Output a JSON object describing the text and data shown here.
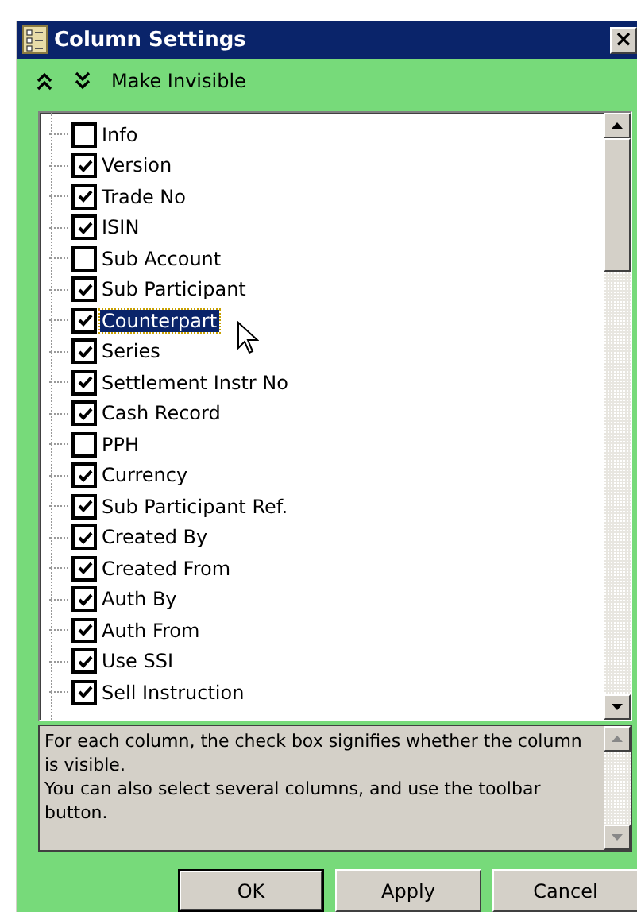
{
  "window": {
    "title": "Column Settings",
    "close": "×"
  },
  "toolbar": {
    "label": "Make Invisible"
  },
  "columns": [
    {
      "label": "Info",
      "checked": false,
      "selected": false
    },
    {
      "label": "Version",
      "checked": true,
      "selected": false
    },
    {
      "label": "Trade No",
      "checked": true,
      "selected": false
    },
    {
      "label": "ISIN",
      "checked": true,
      "selected": false
    },
    {
      "label": "Sub Account",
      "checked": false,
      "selected": false
    },
    {
      "label": "Sub Participant",
      "checked": true,
      "selected": false
    },
    {
      "label": "Counterpart",
      "checked": true,
      "selected": true
    },
    {
      "label": "Series",
      "checked": true,
      "selected": false
    },
    {
      "label": "Settlement Instr No",
      "checked": true,
      "selected": false
    },
    {
      "label": "Cash Record",
      "checked": true,
      "selected": false
    },
    {
      "label": "PPH",
      "checked": false,
      "selected": false
    },
    {
      "label": "Currency",
      "checked": true,
      "selected": false
    },
    {
      "label": "Sub Participant Ref.",
      "checked": true,
      "selected": false
    },
    {
      "label": "Created By",
      "checked": true,
      "selected": false
    },
    {
      "label": "Created From",
      "checked": true,
      "selected": false
    },
    {
      "label": "Auth By",
      "checked": true,
      "selected": false
    },
    {
      "label": "Auth From",
      "checked": true,
      "selected": false
    },
    {
      "label": "Use SSI",
      "checked": true,
      "selected": false
    },
    {
      "label": "Sell Instruction",
      "checked": true,
      "selected": false
    }
  ],
  "description": [
    "For each column, the check box signifies whether the column is visible.",
    "You can also select several columns, and use the toolbar button."
  ],
  "buttons": [
    "OK",
    "Apply",
    "Cancel"
  ]
}
